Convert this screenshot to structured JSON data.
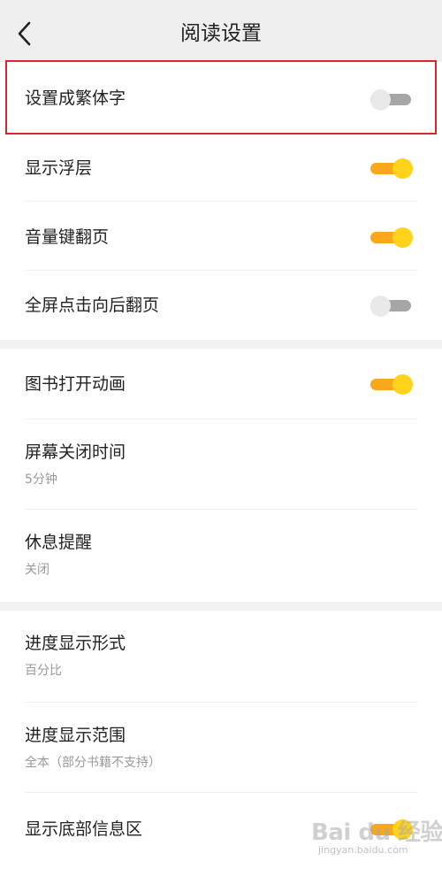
{
  "header": {
    "title": "阅读设置",
    "back_icon": "chevron-left-icon"
  },
  "settings": {
    "traditional_chinese": {
      "label": "设置成繁体字",
      "enabled": false
    },
    "show_overlay": {
      "label": "显示浮层",
      "enabled": true
    },
    "volume_key_paging": {
      "label": "音量键翻页",
      "enabled": true
    },
    "fullscreen_tap_forward": {
      "label": "全屏点击向后翻页",
      "enabled": false
    },
    "book_open_animation": {
      "label": "图书打开动画",
      "enabled": true
    },
    "screen_off_time": {
      "label": "屏幕关闭时间",
      "value": "5分钟"
    },
    "rest_reminder": {
      "label": "休息提醒",
      "value": "关闭"
    },
    "progress_format": {
      "label": "进度显示形式",
      "value": "百分比"
    },
    "progress_range": {
      "label": "进度显示范围",
      "value": "全本（部分书籍不支持）"
    },
    "bottom_info_area": {
      "label": "显示底部信息区",
      "enabled": true
    }
  },
  "colors": {
    "toggle_on_track": "#f8a81a",
    "toggle_on_knob": "#ffd21c",
    "toggle_off_track": "#a6a6a6",
    "toggle_off_knob": "#e9e9e9",
    "highlight_border": "#d9262a",
    "header_bg": "#efefef"
  },
  "watermark": {
    "logo": "Bai du 经验",
    "url": "jingyan.baidu.com"
  }
}
